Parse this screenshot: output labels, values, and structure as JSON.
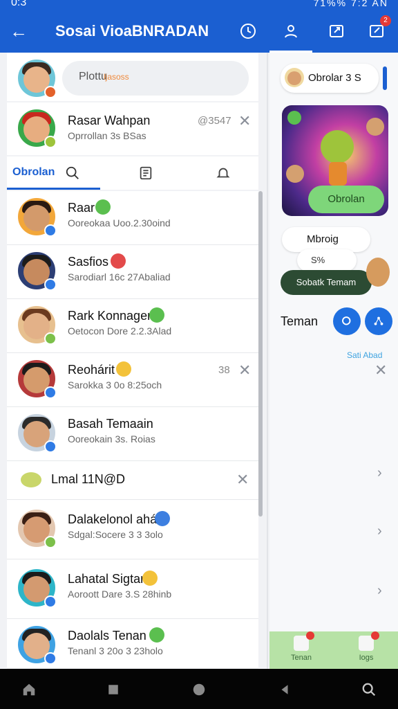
{
  "status_bar": {
    "time": "0:3",
    "right_text": "71%%  7:2 AN"
  },
  "app_bar": {
    "title": "Sosai VioaBNRADAN",
    "notification_count": "2"
  },
  "colors": {
    "primary": "#1b5fd1",
    "accent_green": "#7ed67a",
    "badge_red": "#e53935"
  },
  "left": {
    "search": {
      "text_a": "Plottu",
      "text_b": "ljasoss"
    },
    "pinned": {
      "name": "Rasar Wahpan",
      "sub": "Oprrollan 3s BSas",
      "meta": "@3547"
    },
    "tabs": {
      "active_label": "Obrolan"
    },
    "rows": [
      {
        "name": "Raar",
        "sub": "Ooreokaa Uoo.2.30oind",
        "emoji": "green"
      },
      {
        "name": "Sasfios",
        "sub": "Sarodiarl 16c 27Abaliad",
        "emoji": "red"
      },
      {
        "name": "Rark Konnagen",
        "sub": "Oetocon Dore 2.2.3Alad",
        "emoji": "green"
      },
      {
        "name": "Reohárit",
        "sub": "Sarokka 3 0o 8:25och",
        "emoji": "yellow",
        "meta": "38"
      },
      {
        "name": "Basah Temaain",
        "sub": "Ooreokain 3s. Roias"
      },
      {
        "name": "Lmal 11N@D",
        "divider_row": true
      },
      {
        "name": "Dalakelonol ahá",
        "sub": "Sdgal:Socere 3 3 3olo",
        "emoji": "blue"
      },
      {
        "name": "Lahatal Sigtan",
        "sub": "Aoroott Dare 3.S 28hinb",
        "emoji": "yellow"
      },
      {
        "name": "Daolals Tenan",
        "sub": "Tenanl 3 20o 3 23holo",
        "emoji": "green"
      }
    ]
  },
  "right": {
    "chat_pill": "Obrolar 3 S",
    "game_button": "Obrolan",
    "mini_card": {
      "title": "Mbroig",
      "value": "S%"
    },
    "add_friend": "Sobatk Temam",
    "friends_label": "Teman",
    "link_text": "Sati Abad",
    "bottom_left": "Tenan",
    "bottom_right": "Iogs"
  }
}
